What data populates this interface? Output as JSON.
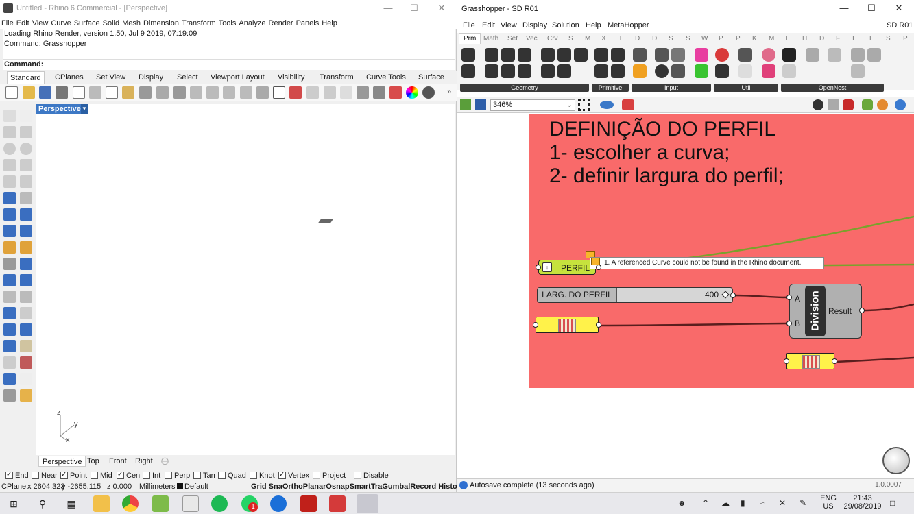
{
  "rhino": {
    "title": "Untitled - Rhino 6 Commercial - [Perspective]",
    "menu": [
      "File",
      "Edit",
      "View",
      "Curve",
      "Surface",
      "Solid",
      "Mesh",
      "Dimension",
      "Transform",
      "Tools",
      "Analyze",
      "Render",
      "Panels",
      "Help"
    ],
    "history": [
      "Loading Rhino Render, version 1.50, Jul  9 2019, 07:19:09",
      "Command: Grasshopper"
    ],
    "command_label": "Command:",
    "toolbar_tabs": [
      "Standard",
      "CPlanes",
      "Set View",
      "Display",
      "Select",
      "Viewport Layout",
      "Visibility",
      "Transform",
      "Curve Tools",
      "Surface"
    ],
    "viewport_label": "Perspective",
    "axis": {
      "z": "z",
      "y": "y",
      "x": "x"
    },
    "viewport_tabs": [
      "Perspective",
      "Top",
      "Front",
      "Right"
    ],
    "osnaps": [
      {
        "label": "End",
        "checked": true
      },
      {
        "label": "Near",
        "checked": false
      },
      {
        "label": "Point",
        "checked": true
      },
      {
        "label": "Mid",
        "checked": false
      },
      {
        "label": "Cen",
        "checked": true
      },
      {
        "label": "Int",
        "checked": false
      },
      {
        "label": "Perp",
        "checked": false
      },
      {
        "label": "Tan",
        "checked": false
      },
      {
        "label": "Quad",
        "checked": false
      },
      {
        "label": "Knot",
        "checked": false
      },
      {
        "label": "Vertex",
        "checked": true
      },
      {
        "label": "Project",
        "checked": false
      },
      {
        "label": "Disable",
        "checked": false
      }
    ],
    "status": {
      "cplane": "CPlane",
      "x": "x 2604.323",
      "y": "y -2655.115",
      "z": "z 0.000",
      "units": "Millimeters",
      "layer": "Default",
      "toggles": "Grid SnaOrthoPlanarOsnapSmartTraGumbalRecord HistoFilte"
    }
  },
  "grasshopper": {
    "title": "Grasshopper - SD R01",
    "doc_name": "SD R01",
    "menu": [
      "File",
      "Edit",
      "View",
      "Display",
      "Solution",
      "Help",
      "MetaHopper"
    ],
    "tabs": [
      "Prm",
      "Math",
      "Set",
      "Vec",
      "Crv",
      "S",
      "M",
      "X",
      "T",
      "D",
      "D",
      "S",
      "S",
      "W",
      "P",
      "P",
      "K",
      "M",
      "L",
      "H",
      "D",
      "F",
      "I",
      "E",
      "S",
      "P"
    ],
    "ribbon_groups": [
      "Geometry",
      "Primitive",
      "Input",
      "Util",
      "OpenNest"
    ],
    "zoom": "346%",
    "group_text": [
      "DEFINIÇÃO DO PERFIL",
      "1- escolher a curva;",
      "2- definir largura do perfil;"
    ],
    "curve_param": "PERFIL",
    "warning": "1. A referenced Curve could not be found in the Rhino document.",
    "slider": {
      "name": "LARG. DO PERFIL",
      "value": "400"
    },
    "division": {
      "title": "Division",
      "input_a": "A",
      "input_b": "B",
      "output": "Result"
    },
    "autosave": "Autosave complete (13 seconds ago)",
    "version": "1.0.0007"
  },
  "taskbar": {
    "lang": "ENG",
    "region": "US",
    "time": "21:43",
    "date": "29/08/2019",
    "whatsapp_badge": "1"
  },
  "colors": {
    "group_fill": "#f96a6a",
    "param_green": "#c6e23d",
    "panel_yellow": "#fff24a",
    "viewport_label": "#3d78c5"
  }
}
